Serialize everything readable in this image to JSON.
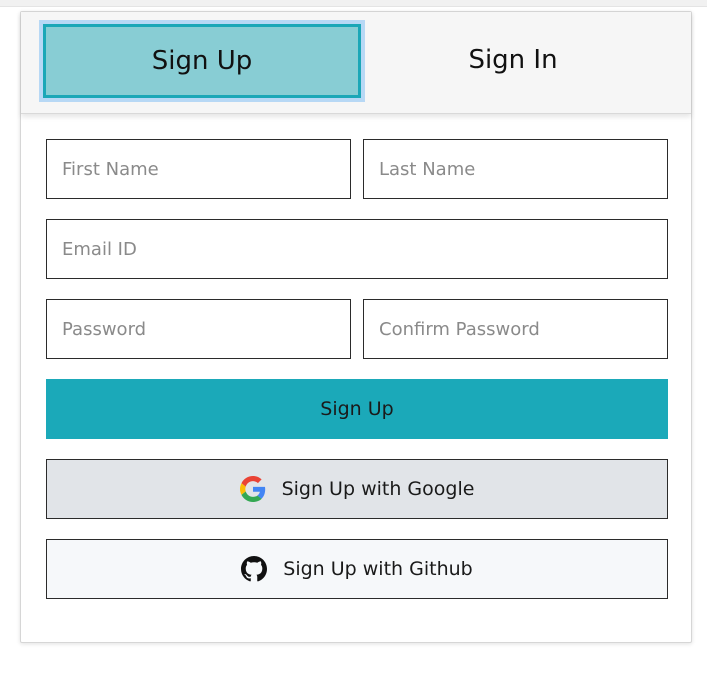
{
  "tabs": {
    "signup": "Sign Up",
    "signin": "Sign In"
  },
  "form": {
    "first_name_placeholder": "First Name",
    "last_name_placeholder": "Last Name",
    "email_placeholder": "Email ID",
    "password_placeholder": "Password",
    "confirm_password_placeholder": "Confirm Password"
  },
  "buttons": {
    "signup": "Sign Up",
    "google": "Sign Up with Google",
    "github": "Sign Up with Github"
  },
  "icons": {
    "google": "google-icon",
    "github": "github-icon"
  },
  "colors": {
    "accent": "#1ba9b9",
    "active_tab_bg": "#88cdd4",
    "google_button_bg": "#e1e4e8",
    "github_button_bg": "#f6f8fa"
  }
}
